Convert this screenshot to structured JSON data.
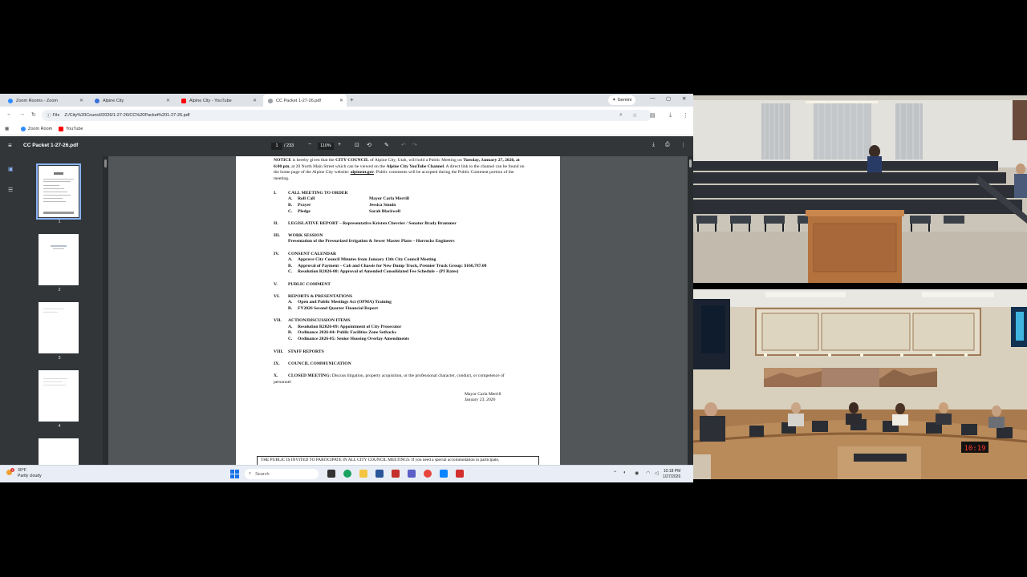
{
  "tabs": [
    {
      "label": "Zoom Rooms - Zoom",
      "color": "#2d8cff"
    },
    {
      "label": "Alpine City",
      "color": "#3b6fd8"
    },
    {
      "label": "Alpine City - YouTube",
      "color": "#ff0000"
    },
    {
      "label": "CC Packet 1-27-26.pdf",
      "color": "#888888"
    }
  ],
  "gemini": "Gemini",
  "address": {
    "label": "File",
    "url": "Z:/City%20Council/2026/1-27-26/CC%20Packet%201-27-26.pdf"
  },
  "bookmarks": [
    {
      "label": "Zoom Room",
      "color": "#2d8cff"
    },
    {
      "label": "YouTube",
      "color": "#ff0000"
    }
  ],
  "pdf": {
    "filename": "CC Packet 1-27-26.pdf",
    "page": "1",
    "total": "/ 233",
    "zoom": "110%",
    "thumb_pages": [
      "1",
      "2",
      "3",
      "4"
    ]
  },
  "doc": {
    "notice_1": "NOTICE",
    "notice_2": " is hereby given that the ",
    "notice_3": "CITY COUNCIL",
    "notice_4": " of Alpine City, Utah, will hold a Public Meeting on ",
    "notice_5": "Tuesday, January 27, 2026, at 6:00 pm.",
    "notice_6": " at 20 North Main Street which can be viewed on the ",
    "notice_7": "Alpine City YouTube Channel",
    "notice_8": ". A direct link to the channel can be found on the home page of the Alpine City website: ",
    "notice_9": "alpineut.gov",
    "notice_10": ". Public comments will be accepted during the Public Comment portion of the meeting.",
    "s1": {
      "num": "I.",
      "title": "CALL MEETING TO ORDER"
    },
    "s1_items": [
      {
        "let": "A.",
        "text": "Roll Call",
        "who": "Mayor Carla Merrill"
      },
      {
        "let": "B.",
        "text": "Prayer",
        "who": "Jessica Smuin"
      },
      {
        "let": "C.",
        "text": "Pledge",
        "who": "Sarah Blackwell"
      }
    ],
    "s2": {
      "num": "II.",
      "title": "LEGISLATIVE REPORT – Representative Kristen Chevrier / Senator Brady Brammer"
    },
    "s3": {
      "num": "III.",
      "title": "WORK SESSION"
    },
    "s3_sub": "Presentation of the Pressurized Irrigation & Sewer Master Plans – Horrocks Engineers",
    "s4": {
      "num": "IV.",
      "title": "CONSENT CALENDAR"
    },
    "s4_items": [
      {
        "let": "A.",
        "text": "Approve City Council Minutes from January 13th City Council Meeting"
      },
      {
        "let": "B.",
        "text": "Approval of Payment – Cab and Chassis for New Dump Truck, Premier Truck Group: $160,787.00"
      },
      {
        "let": "C.",
        "text": "Resolution R2026-08: Approval of Amended Consolidated Fee Schedule – (PI Rates)"
      }
    ],
    "s5": {
      "num": "V.",
      "title": "PUBLIC COMMENT"
    },
    "s6": {
      "num": "VI.",
      "title": "REPORTS & PRESENTATIONS"
    },
    "s6_items": [
      {
        "let": "A.",
        "text": "Open and Public Meetings Act (OPMA) Training"
      },
      {
        "let": "B.",
        "text": "FY2026 Second Quarter Financial Report"
      }
    ],
    "s7": {
      "num": "VII.",
      "title": "ACTION/DISCUSSION ITEMS"
    },
    "s7_items": [
      {
        "let": "A.",
        "text": "Resolution R2026-09: Appointment of City Prosecutor"
      },
      {
        "let": "B.",
        "text": "Ordinance 2026-04: Public Facilities Zone Setbacks"
      },
      {
        "let": "C.",
        "text": "Ordinance 2026-05: Senior Housing Overlay Amendments"
      }
    ],
    "s8": {
      "num": "VIII.",
      "title": "STAFF REPORTS"
    },
    "s9": {
      "num": "IX.",
      "title": "COUNCIL COMMUNICATION"
    },
    "s10": {
      "num": "X.",
      "title": "CLOSED MEETING:"
    },
    "s10_text": " Discuss litigation, property acquisition, or the professional character, conduct, or competence of personnel",
    "sign_name": "Mayor Carla Merrill",
    "sign_date": "January 23, 2026",
    "footer": "THE PUBLIC IS INVITED TO PARTICIPATE IN ALL CITY COUNCIL MEETINGS.  If you need a special accommodation to participate,"
  },
  "taskbar": {
    "temp": "30°F",
    "weather": "Partly cloudy",
    "badge": "1",
    "search": "Search",
    "time": "10:18 PM",
    "date": "1/27/2026"
  },
  "video2": {
    "clock": "10:19"
  }
}
